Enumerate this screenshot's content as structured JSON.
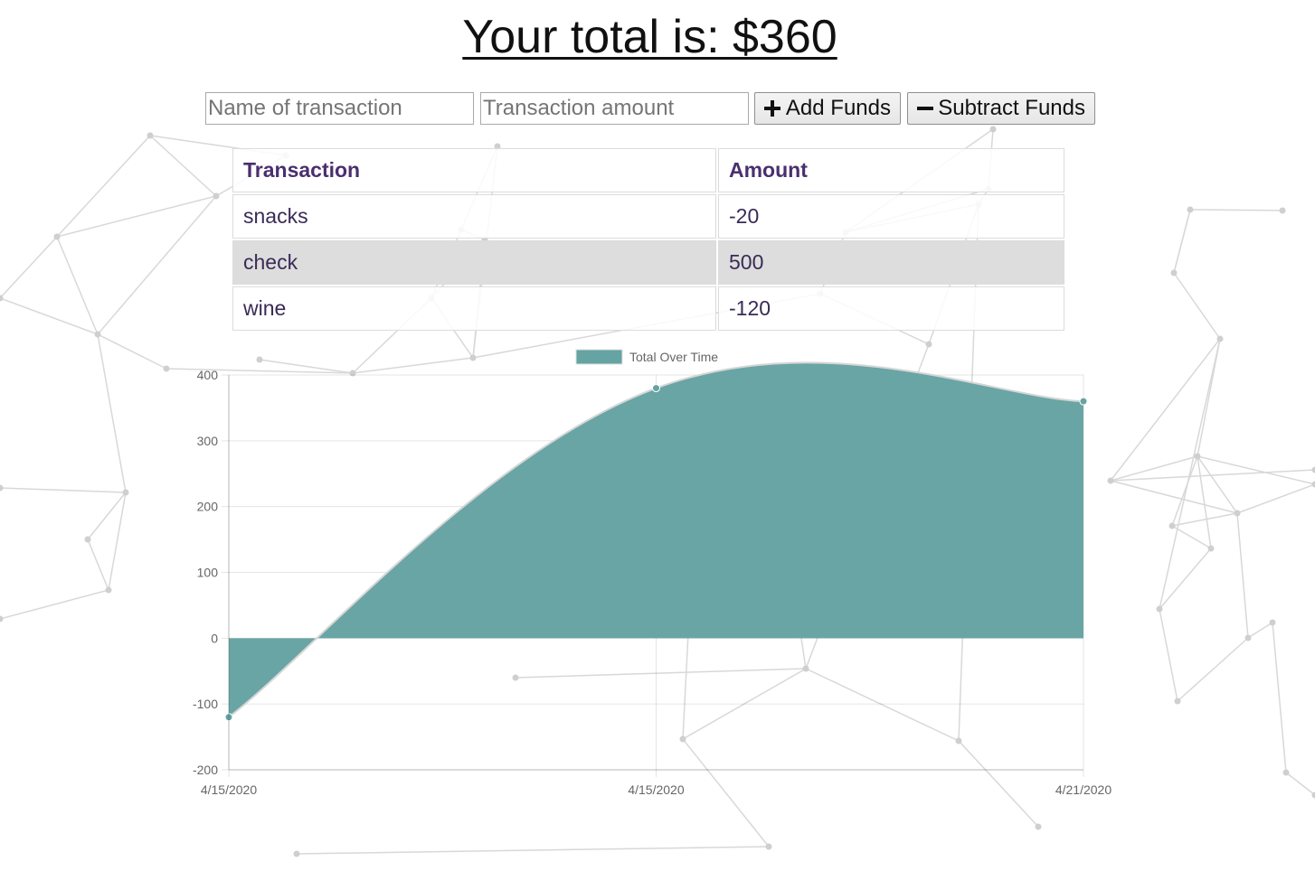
{
  "header": {
    "total_label": "Your total is: $360"
  },
  "form": {
    "name_placeholder": "Name of transaction",
    "amount_placeholder": "Transaction amount",
    "add_label": "Add Funds",
    "subtract_label": "Subtract Funds"
  },
  "table": {
    "headers": [
      "Transaction",
      "Amount"
    ],
    "rows": [
      {
        "name": "snacks",
        "amount": "-20"
      },
      {
        "name": "check",
        "amount": "500"
      },
      {
        "name": "wine",
        "amount": "-120"
      }
    ]
  },
  "chart_data": {
    "type": "area",
    "title": "",
    "xlabel": "",
    "ylabel": "",
    "categories": [
      "4/15/2020",
      "4/15/2020",
      "4/21/2020"
    ],
    "series": [
      {
        "name": "Total Over Time",
        "values": [
          -120,
          380,
          360
        ],
        "color": "#66a3a3"
      }
    ],
    "ylim": [
      -200,
      400
    ],
    "yticks": [
      400,
      300,
      200,
      100,
      0,
      -100,
      -200
    ],
    "grid": true,
    "legend": "top"
  }
}
